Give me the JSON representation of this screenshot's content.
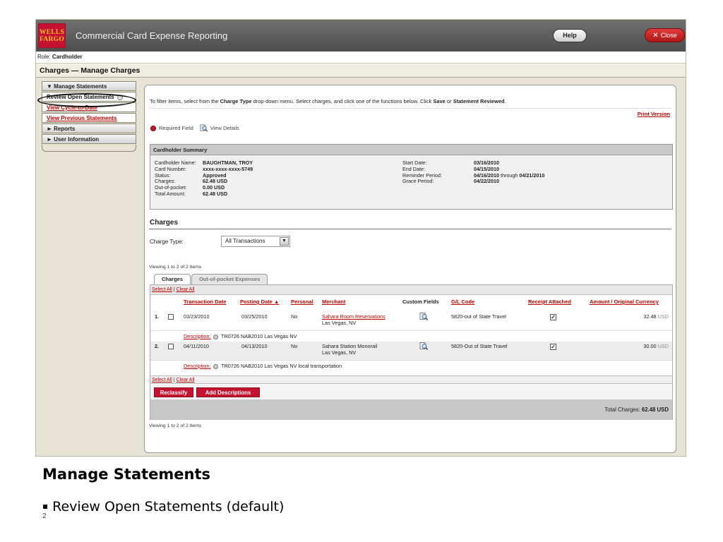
{
  "header": {
    "logo_line1": "WELLS",
    "logo_line2": "FARGO",
    "app_title": "Commercial Card Expense Reporting",
    "help_label": "Help",
    "close_label": "Close",
    "close_glyph": "✕"
  },
  "role": {
    "label": "Role:",
    "value": "Cardholder"
  },
  "page_title": "Charges — Manage Charges",
  "sidebar": {
    "manage_statements": "▼  Manage Statements",
    "review_open": "Review Open Statements",
    "view_cycle": "View Cycle-to-Date",
    "view_previous": "View Previous Statements",
    "reports": "►  Reports",
    "user_info": "►  User Information"
  },
  "intro": {
    "p1": "To filter items, select from the ",
    "b1": "Charge Type",
    "p2": " drop-down menu. Select charges, and click one of the functions below. Click ",
    "b2": "Save",
    "p3": " or ",
    "b3": "Statement Reviewed",
    "p4": "."
  },
  "print_version": "Print Version",
  "legend": {
    "required": "Required Field",
    "view_details": "View Details"
  },
  "summary": {
    "heading": "Cardholder Summary",
    "left_labels": [
      "Cardholder Name:",
      "Card Number:",
      "Status:",
      "Charges:",
      "Out-of-pocket:",
      "Total Amount:"
    ],
    "left_values": [
      "BAUGHTMAN, TROY",
      "xxxx-xxxx-xxxx-5749",
      "Approved",
      "62.48 USD",
      "0.00 USD",
      "62.48 USD"
    ],
    "right_labels": [
      "Start Date:",
      "End Date:",
      "Reminder Period:",
      "Grace Period:"
    ],
    "start_date": "03/16/2010",
    "end_date": "04/15/2010",
    "reminder_from": "04/16/2010",
    "reminder_through": " through ",
    "reminder_to": "04/21/2010",
    "grace_period": "04/22/2010"
  },
  "charges": {
    "title": "Charges",
    "charge_type_label": "Charge Type:",
    "charge_type_value": "All Transactions",
    "viewing_top": "Viewing 1 to 2 of 2 Items",
    "viewing_bottom": "Viewing 1 to 2 of 2 Items",
    "tabs": [
      "Charges",
      "Out-of-pocket Expenses"
    ],
    "select_all": "Select All",
    "sep": " | ",
    "clear_all": "Clear All",
    "columns": {
      "transaction_date": "Transaction Date",
      "posting_date": "Posting Date ▲",
      "personal": "Personal",
      "merchant": "Merchant",
      "custom_fields": "Custom Fields",
      "gl_code": "G/L Code",
      "receipt_attached": "Receipt Attached",
      "amount": "Amount / Original Currency"
    },
    "rows": [
      {
        "num": "1.",
        "transaction_date": "03/23/2010",
        "posting_date": "03/25/2010",
        "personal": "No",
        "merchant": "Sahara Room Reservations",
        "merchant_city": "Las Vegas, NV",
        "gl_code": "5820-out of State Travel",
        "receipt": "✓",
        "amount": "32.48",
        "currency": " USD",
        "description_label": "Description:",
        "description": "TR0726 NAB2010 Las Vegas NV"
      },
      {
        "num": "2.",
        "transaction_date": "04/11/2010",
        "posting_date": "04/13/2010",
        "personal": "No",
        "merchant": "Sahara Station Monorail",
        "merchant_city": "Las Vegas, NV",
        "gl_code": "5820-Out of State Travel",
        "receipt": "✓",
        "amount": "30.00",
        "currency": " USD",
        "description_label": "Description:",
        "description": "TR0726 NAB2010 Las Vegas NV local transportation"
      }
    ],
    "reclassify": "Reclassify",
    "add_descriptions": "Add Descriptions",
    "total_label": "Total Charges: ",
    "total_value": "62.48 USD"
  },
  "slide": {
    "title": "Manage Statements",
    "bullet_glyph": "▪",
    "bullet": "Review Open Statements (default)",
    "page_number": "2"
  },
  "colors": {
    "brand_red": "#c41230",
    "link_red": "#bb0000",
    "logo_gold": "#f3c02a",
    "header_grey": "#5a5a5a"
  }
}
